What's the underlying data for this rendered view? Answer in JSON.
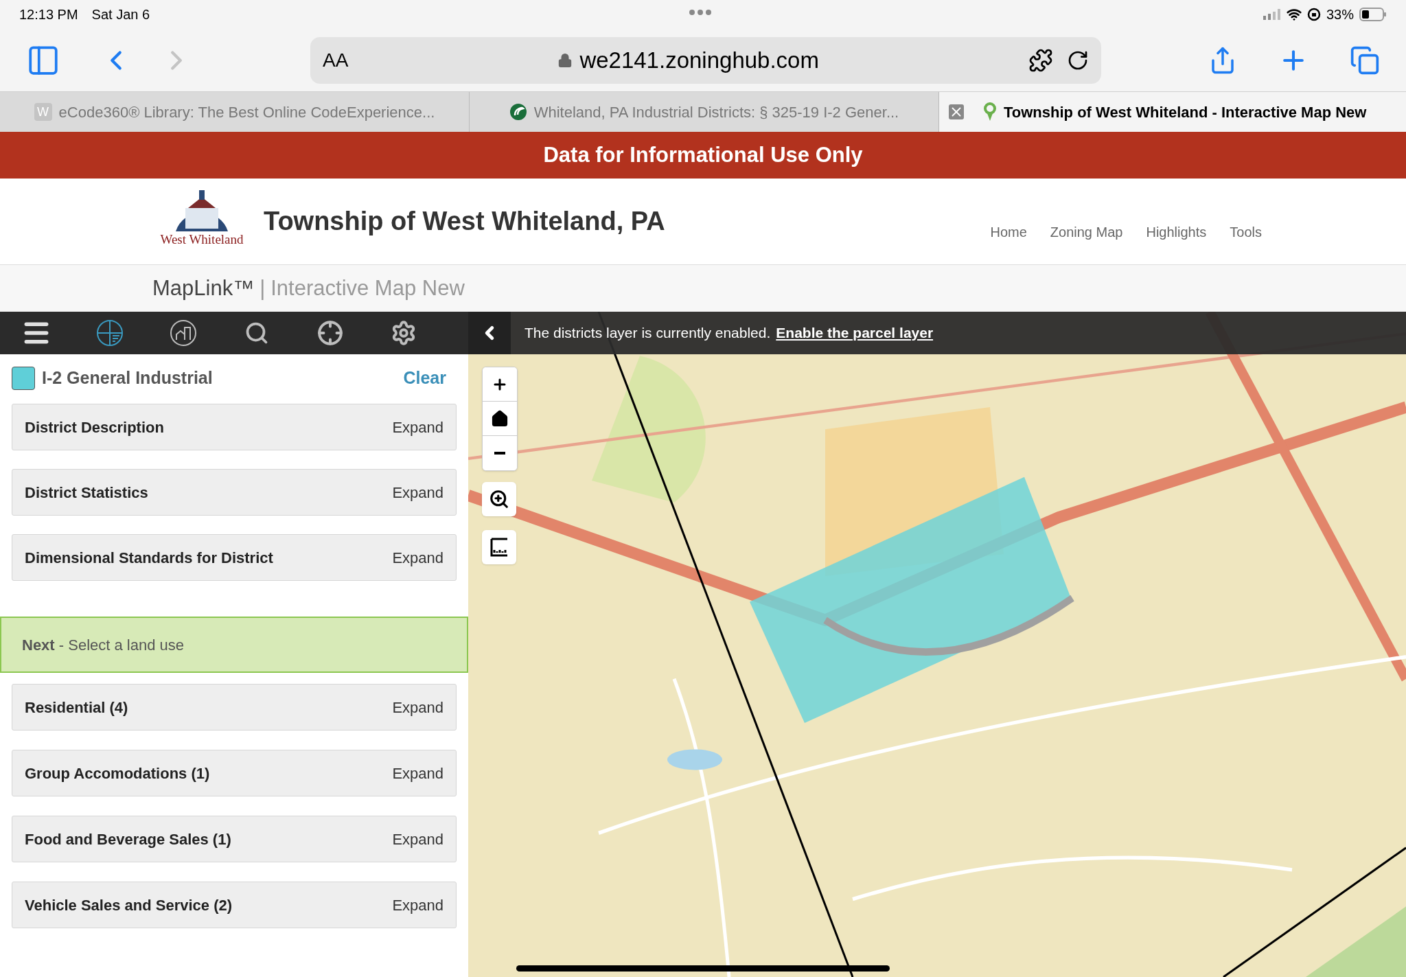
{
  "status_bar": {
    "time": "12:13 PM",
    "date": "Sat Jan 6",
    "battery": "33%"
  },
  "browser": {
    "text_size": "AA",
    "url": "we2141.zoninghub.com"
  },
  "tabs": [
    {
      "title": "eCode360® Library: The Best Online CodeExperience...",
      "favicon": "W",
      "selected": false
    },
    {
      "title": "Whiteland, PA Industrial Districts: § 325-19 I-2 Gener...",
      "selected": false
    },
    {
      "title": "Township of West Whiteland - Interactive Map New",
      "selected": true
    }
  ],
  "banner": "Data for Informational Use Only",
  "header": {
    "logo_text": "West Whiteland",
    "title": "Township of West Whiteland, PA",
    "nav": [
      "Home",
      "Zoning Map",
      "Highlights",
      "Tools"
    ]
  },
  "subheader": {
    "product": "MapLink™",
    "separator": "|",
    "page": "Interactive Map New"
  },
  "toolbar": {
    "tools": [
      {
        "kind": "menu",
        "selected": false
      },
      {
        "kind": "layers",
        "selected": true
      },
      {
        "kind": "property",
        "selected": false
      },
      {
        "kind": "search",
        "selected": false
      },
      {
        "kind": "locate",
        "selected": false
      },
      {
        "kind": "settings",
        "selected": false
      }
    ]
  },
  "notice": {
    "text": "The districts layer is currently enabled.",
    "link": "Enable the parcel layer"
  },
  "district": {
    "name": "I-2 General Industrial",
    "color": "#5fcfd8",
    "clear": "Clear"
  },
  "district_sections": [
    {
      "title": "District Description",
      "action": "Expand"
    },
    {
      "title": "District Statistics",
      "action": "Expand"
    },
    {
      "title": "Dimensional Standards for District",
      "action": "Expand"
    }
  ],
  "next_step": "**Next** - Select a land use",
  "land_uses": [
    {
      "title": "Residential (4)",
      "action": "Expand"
    },
    {
      "title": "Group Accomodations (1)",
      "action": "Expand"
    },
    {
      "title": "Food and Beverage Sales (1)",
      "action": "Expand"
    },
    {
      "title": "Vehicle Sales and Service (2)",
      "action": "Expand"
    }
  ],
  "map_controls": [
    {
      "kind": "zoom-in"
    },
    {
      "kind": "home"
    },
    {
      "kind": "zoom-out"
    },
    {
      "kind": "zoom-box"
    },
    {
      "kind": "measure"
    }
  ]
}
